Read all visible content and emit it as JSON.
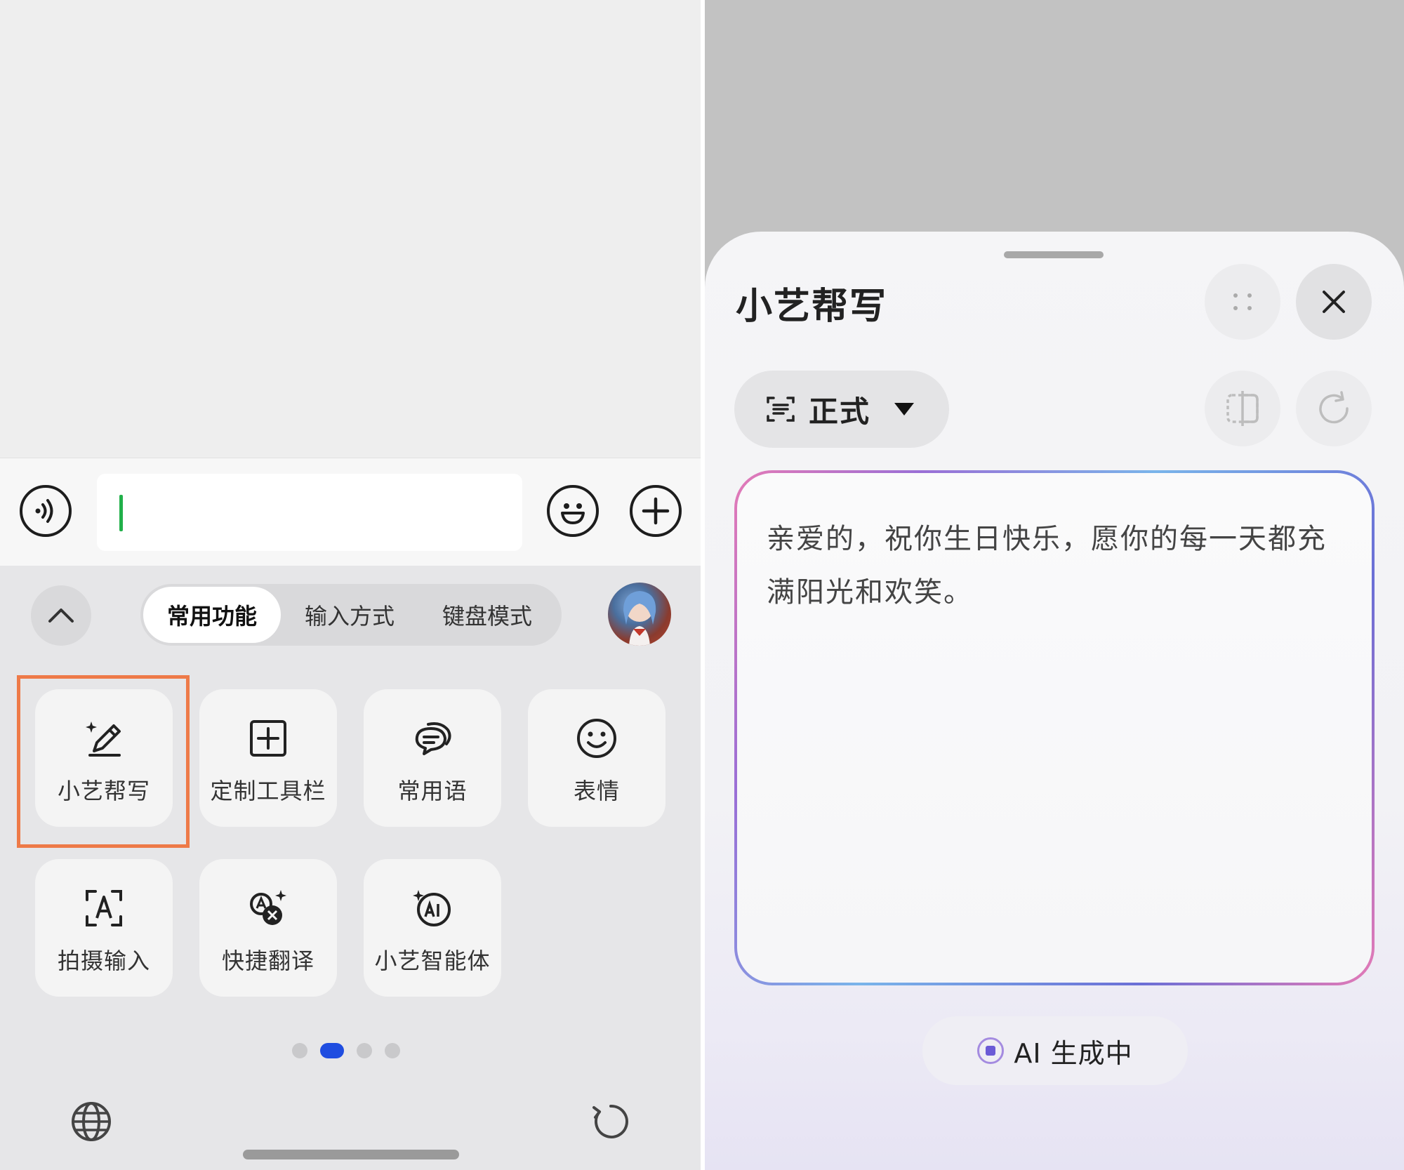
{
  "keyboard": {
    "tabs": [
      "常用功能",
      "输入方式",
      "键盘模式"
    ],
    "tiles": [
      {
        "label": "小艺帮写",
        "icon": "magic-pen-icon"
      },
      {
        "label": "定制工具栏",
        "icon": "add-square-icon"
      },
      {
        "label": "常用语",
        "icon": "chat-bubbles-icon"
      },
      {
        "label": "表情",
        "icon": "smiley-icon"
      },
      {
        "label": "拍摄输入",
        "icon": "scan-text-icon"
      },
      {
        "label": "快捷翻译",
        "icon": "translate-icon"
      },
      {
        "label": "小艺智能体",
        "icon": "ai-agent-icon"
      }
    ],
    "page_indicator": {
      "total": 4,
      "current": 2
    },
    "highlight_color": "#ee7a48",
    "caret_color": "#21b04a"
  },
  "sheet": {
    "title": "小艺帮写",
    "style_label": "正式",
    "generated_text": "亲爱的，祝你生日快乐，愿你的每一天都充满阳光和欢笑。",
    "status": "AI 生成中"
  }
}
